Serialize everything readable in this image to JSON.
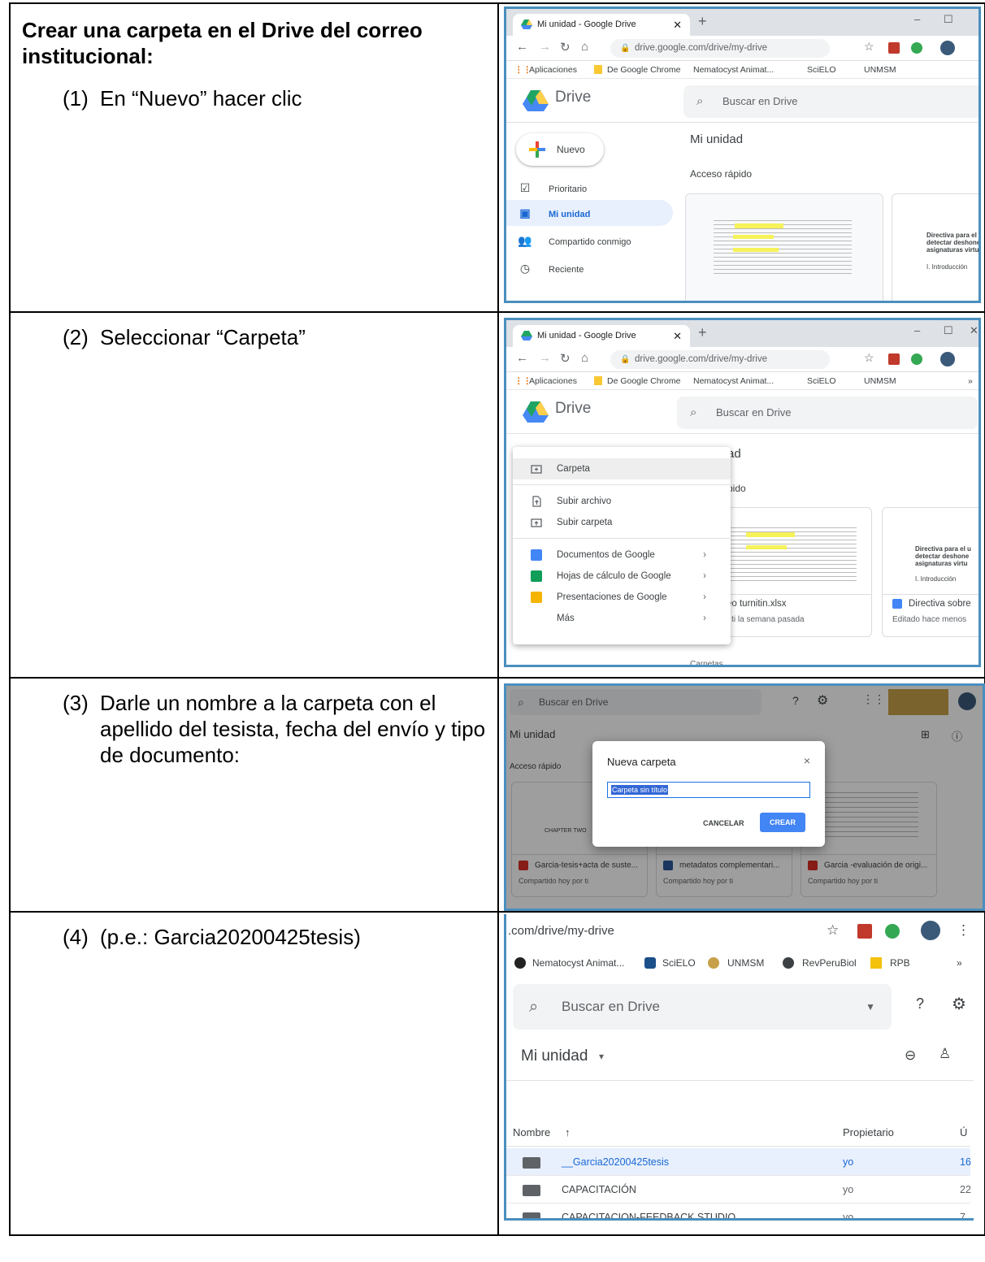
{
  "instructions": {
    "heading": "Crear una carpeta en el Drive del correo institucional:",
    "steps": [
      {
        "num": "(1)",
        "text": "En “Nuevo” hacer clic"
      },
      {
        "num": "(2)",
        "text": "Seleccionar “Carpeta”"
      },
      {
        "num": "(3)",
        "text": "Darle un nombre a la carpeta con el apellido del tesista, fecha del envío y tipo de documento:"
      },
      {
        "num": "(4)",
        "text": "(p.e.: Garcia20200425tesis)"
      }
    ]
  },
  "browser": {
    "tab_title": "Mi unidad - Google Drive",
    "url": "drive.google.com/drive/my-drive",
    "url_partial": ".com/drive/my-drive",
    "bookmarks": [
      "Aplicaciones",
      "De Google Chrome",
      "Nematocyst Animat...",
      "SciELO",
      "UNMSM",
      "RevPeruBiol",
      "RPB"
    ],
    "more_glyph": "»"
  },
  "drive": {
    "product": "Drive",
    "search_placeholder": "Buscar en Drive",
    "new_button": "Nuevo",
    "my_drive": "Mi unidad",
    "quick_access": "Acceso rápido",
    "sidebar": [
      "Prioritario",
      "Mi unidad",
      "Compartido conmigo",
      "Reciente"
    ],
    "doc_preview_lines": [
      "Directiva para el u",
      "detectar deshone",
      "asignaturas virtu",
      "I. Introducción"
    ],
    "card1_name": "eo turnitin.xlsx",
    "card1_meta": "r ti la semana pasada",
    "card2_name": "Directiva sobre",
    "card2_meta": "Editado hace menos",
    "folders_label": "Carpetas",
    "menu_partial_unit": "ad",
    "menu_partial_quick": "pido"
  },
  "new_menu": {
    "items": [
      "Carpeta",
      "Subir archivo",
      "Subir carpeta",
      "Documentos de Google",
      "Hojas de cálculo de Google",
      "Presentaciones de Google",
      "Más"
    ]
  },
  "new_folder_dialog": {
    "title": "Nueva carpeta",
    "input_value": "Carpeta sin título",
    "cancel": "CANCELAR",
    "create": "CREAR",
    "close": "×",
    "files": [
      {
        "name": "Garcia-tesis+acta de suste...",
        "meta": "Compartido hoy por ti",
        "type": "PDF"
      },
      {
        "name": "metadatos complementari...",
        "meta": "Compartido hoy por ti",
        "type": "W"
      },
      {
        "name": "Garcia -evaluación de origi...",
        "meta": "Compartido hoy por ti",
        "type": "PDF"
      }
    ],
    "preview_heading": "CHAPTER TWO"
  },
  "file_list": {
    "col_name": "Nombre",
    "col_owner": "Propietario",
    "col_last": "Ú",
    "rows": [
      {
        "name": "__Garcia20200425tesis",
        "owner": "yo",
        "date": "16"
      },
      {
        "name": "CAPACITACIÓN",
        "owner": "yo",
        "date": "22"
      },
      {
        "name": "CAPACITACION-FEEDBACK STUDIO",
        "owner": "yo",
        "date": "7"
      }
    ]
  },
  "colors": {
    "accent_blue": "#1a73e8",
    "selected_bg": "#e8f0fe",
    "frame_blue": "#4a8fbf",
    "highlight_row": "#e8f0fe"
  }
}
